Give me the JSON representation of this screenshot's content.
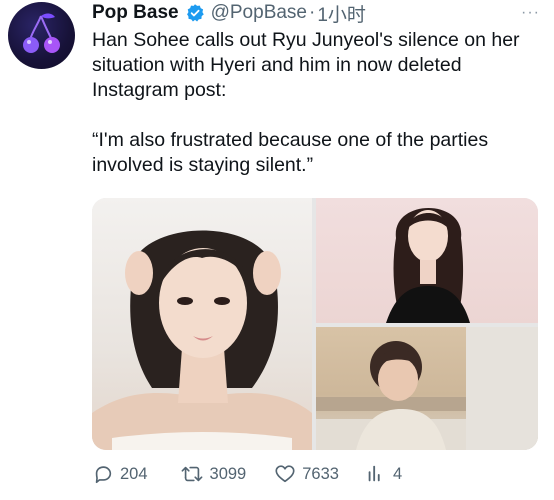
{
  "tweet": {
    "name": "Pop Base",
    "handle": "@PopBase",
    "separator": "·",
    "time": "1小时",
    "text_line1": "Han Sohee calls out Ryu Junyeol's silence on her situation with Hyeri and him in now deleted Instagram post:",
    "quote": "“I'm also frustrated because one of the parties involved is staying silent.”"
  },
  "stats": {
    "replies": "204",
    "retweets": "3099",
    "likes": "7633",
    "views": "4"
  },
  "colors": {
    "text": "#0f1419",
    "muted": "#536471",
    "verified": "#1d9bf0",
    "avatar_bg": "#171238",
    "cherry": "#8b5cf6"
  },
  "icons": {
    "verified": "verified-badge-icon",
    "more": "more-icon",
    "reply": "reply-icon",
    "retweet": "retweet-icon",
    "like": "heart-icon",
    "views": "views-chart-icon"
  }
}
